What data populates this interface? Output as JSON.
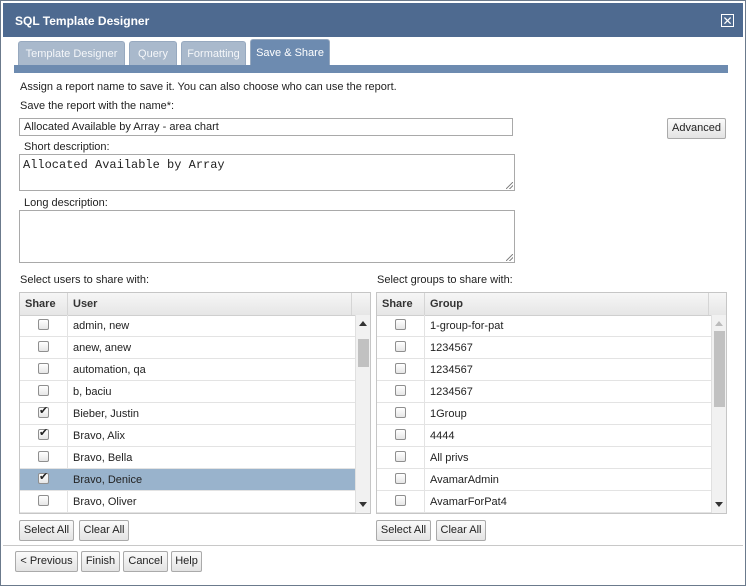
{
  "window": {
    "title": "SQL Template Designer",
    "close_label": "✕"
  },
  "tabs": [
    {
      "label": "Template Designer",
      "active": false
    },
    {
      "label": "Query",
      "active": false
    },
    {
      "label": "Formatting",
      "active": false
    },
    {
      "label": "Save & Share",
      "active": true
    }
  ],
  "form": {
    "instructions": "Assign a report name to save it. You can also choose who can use the report.",
    "name_label": "Save the report with the name*:",
    "name_value": "Allocated Available by Array - area chart",
    "advanced_label": "Advanced",
    "short_desc_label": "Short description:",
    "short_desc_value": "Allocated Available by Array",
    "long_desc_label": "Long description:",
    "long_desc_value": ""
  },
  "users": {
    "section_label": "Select users to share with:",
    "columns": [
      "Share",
      "User"
    ],
    "rows": [
      {
        "name": "admin, new",
        "checked": false,
        "selected": false
      },
      {
        "name": "anew, anew",
        "checked": false,
        "selected": false
      },
      {
        "name": "automation, qa",
        "checked": false,
        "selected": false
      },
      {
        "name": "b, baciu",
        "checked": false,
        "selected": false
      },
      {
        "name": "Bieber, Justin",
        "checked": true,
        "selected": false
      },
      {
        "name": "Bravo, Alix",
        "checked": true,
        "selected": false
      },
      {
        "name": "Bravo, Bella",
        "checked": false,
        "selected": false
      },
      {
        "name": "Bravo, Denice",
        "checked": true,
        "selected": true
      },
      {
        "name": "Bravo, Oliver",
        "checked": false,
        "selected": false
      }
    ],
    "select_all_label": "Select All",
    "clear_all_label": "Clear All"
  },
  "groups": {
    "section_label": "Select groups to share with:",
    "columns": [
      "Share",
      "Group"
    ],
    "rows": [
      {
        "name": "1-group-for-pat",
        "checked": false
      },
      {
        "name": "1234567",
        "checked": false
      },
      {
        "name": "1234567",
        "checked": false
      },
      {
        "name": "1234567",
        "checked": false
      },
      {
        "name": "1Group",
        "checked": false
      },
      {
        "name": "4444",
        "checked": false
      },
      {
        "name": "All privs",
        "checked": false
      },
      {
        "name": "AvamarAdmin",
        "checked": false
      },
      {
        "name": "AvamarForPat4",
        "checked": false
      }
    ],
    "select_all_label": "Select All",
    "clear_all_label": "Clear All"
  },
  "footer": {
    "previous_label": "< Previous",
    "finish_label": "Finish",
    "cancel_label": "Cancel",
    "help_label": "Help"
  },
  "colors": {
    "titlebar": "#4e6a90",
    "tab_active": "#6d8bb0",
    "tab_inactive": "#a9b9cc",
    "row_selected": "#99b3cc"
  }
}
